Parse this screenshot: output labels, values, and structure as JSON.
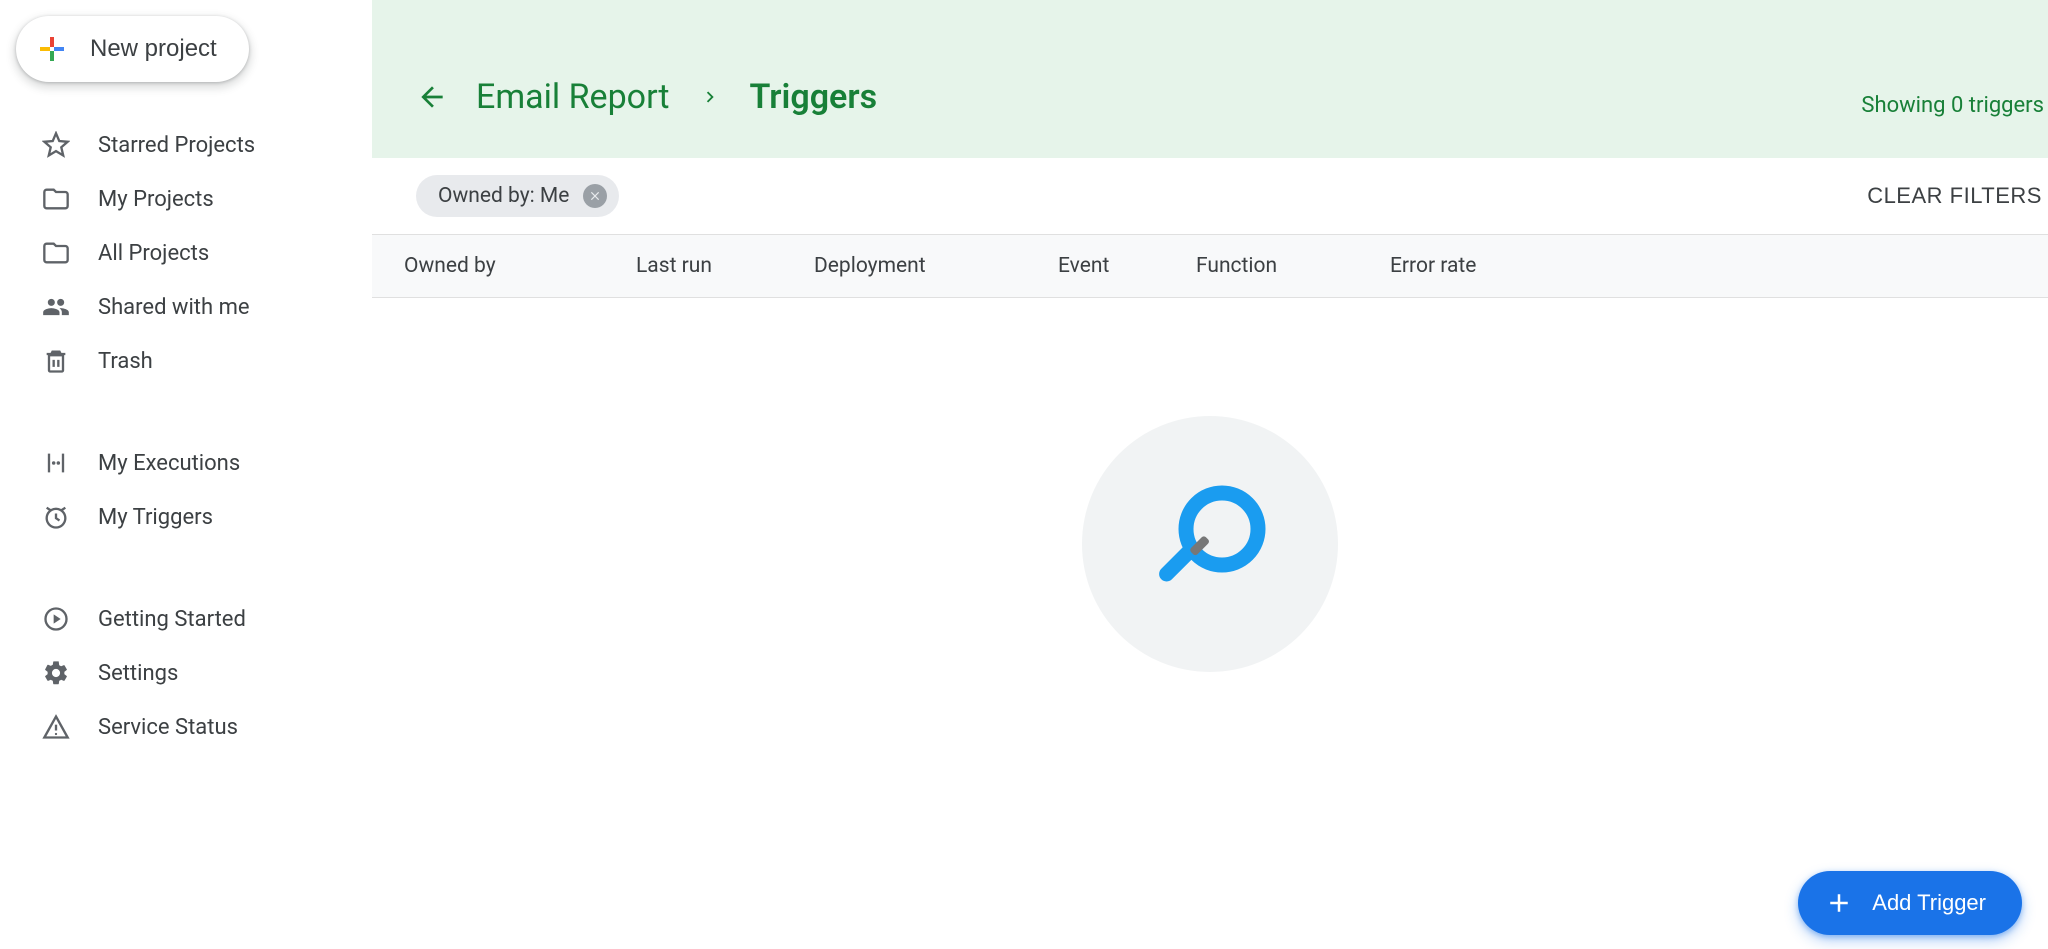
{
  "new_project_label": "New project",
  "sidebar": {
    "group1": [
      {
        "key": "starred",
        "label": "Starred Projects"
      },
      {
        "key": "my",
        "label": "My Projects"
      },
      {
        "key": "all",
        "label": "All Projects"
      },
      {
        "key": "shared",
        "label": "Shared with me"
      },
      {
        "key": "trash",
        "label": "Trash"
      }
    ],
    "group2": [
      {
        "key": "executions",
        "label": "My Executions"
      },
      {
        "key": "triggers",
        "label": "My Triggers"
      }
    ],
    "group3": [
      {
        "key": "getting",
        "label": "Getting Started"
      },
      {
        "key": "settings",
        "label": "Settings"
      },
      {
        "key": "status",
        "label": "Service Status"
      }
    ]
  },
  "breadcrumb": {
    "project": "Email Report",
    "current": "Triggers"
  },
  "status_text": "Showing 0 triggers",
  "filter_chip": "Owned by: Me",
  "clear_filters_label": "CLEAR FILTERS",
  "columns": {
    "owned": "Owned by",
    "last": "Last run",
    "deploy": "Deployment",
    "event": "Event",
    "func": "Function",
    "err": "Error rate"
  },
  "fab_label": "Add Trigger"
}
